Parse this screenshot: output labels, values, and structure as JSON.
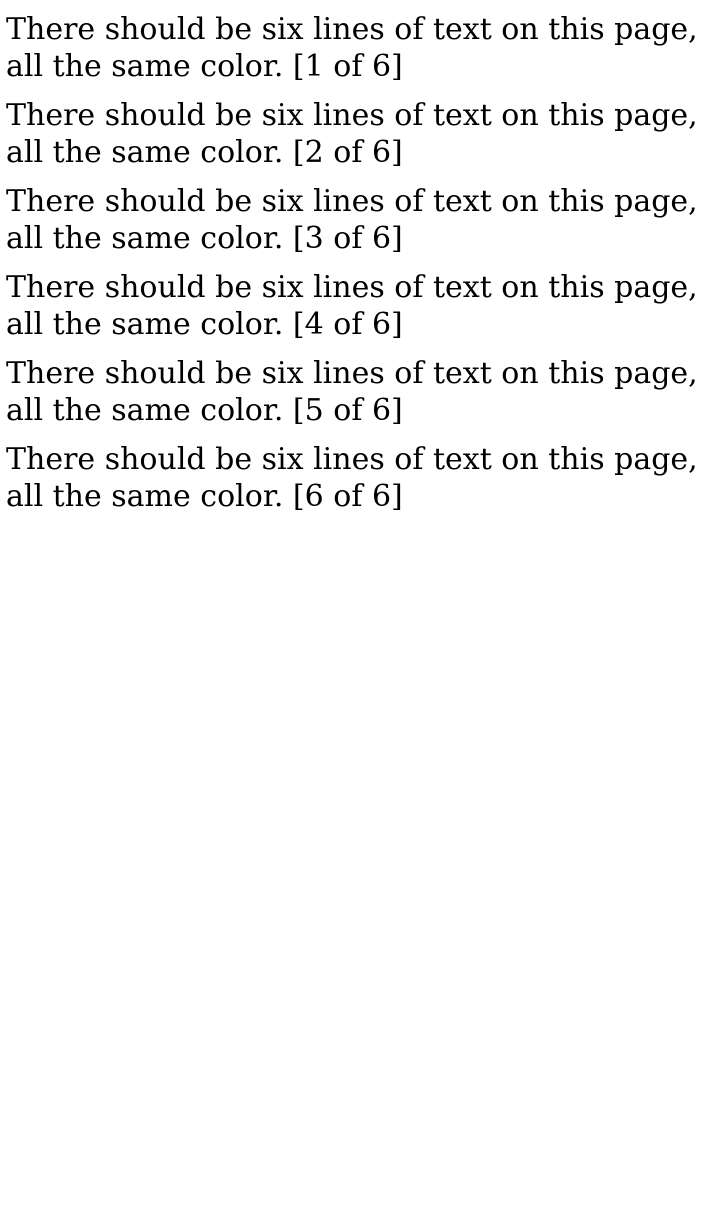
{
  "text_color": "#000000",
  "lines": [
    "There should be six lines of text on this page,\nall the same color. [1 of 6]",
    "There should be six lines of text on this page,\nall the same color. [2 of 6]",
    "There should be six lines of text on this page,\nall the same color. [3 of 6]",
    "There should be six lines of text on this page,\nall the same color. [4 of 6]",
    "There should be six lines of text on this page,\nall the same color. [5 of 6]",
    "There should be six lines of text on this page,\nall the same color. [6 of 6]"
  ]
}
